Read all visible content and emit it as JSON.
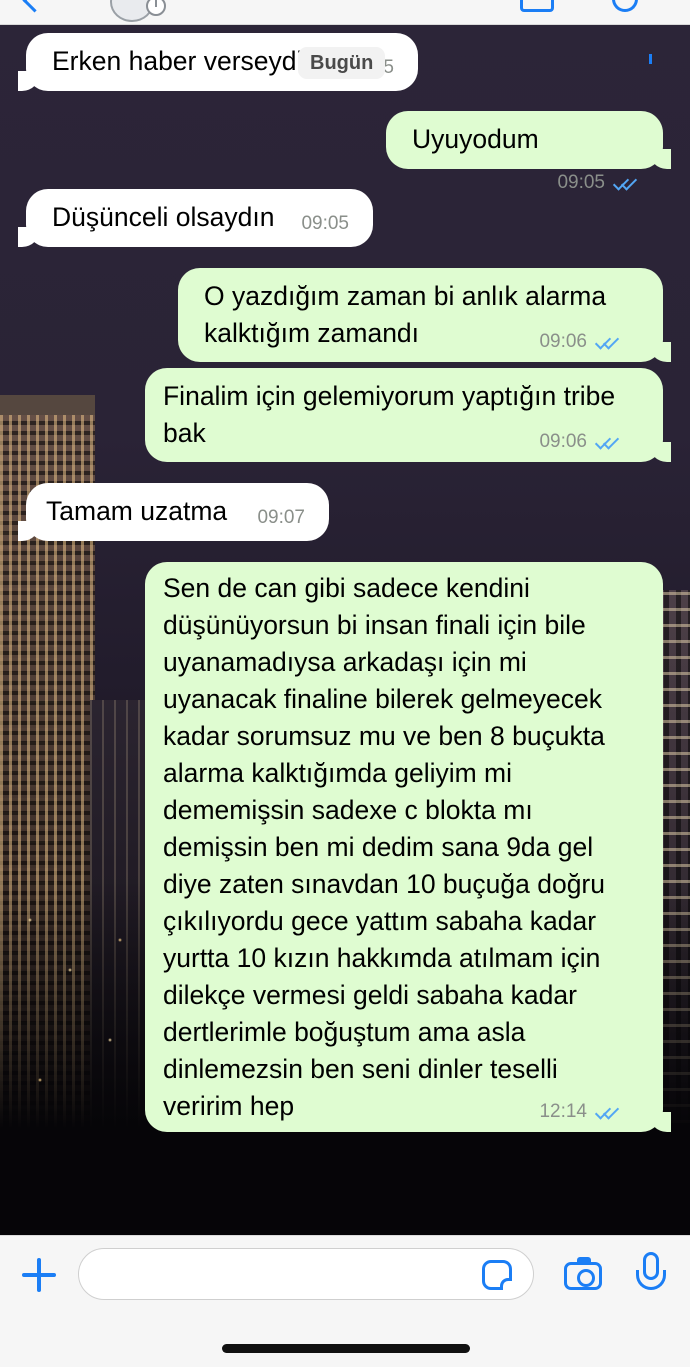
{
  "chat": {
    "date_label": "Bugün",
    "messages": [
      {
        "dir": "in",
        "text": "Erken haber verseydin",
        "time": "09:05"
      },
      {
        "dir": "out",
        "text": "Uyuyodum",
        "time": "09:05",
        "read": true
      },
      {
        "dir": "in",
        "text": "Düşünceli olsaydın",
        "time": "09:05"
      },
      {
        "dir": "out",
        "text": "O yazdığım zaman bi anlık alarma kalktığım zamandı",
        "time": "09:06",
        "read": true
      },
      {
        "dir": "out",
        "text": "Finalim için gelemiyorum yaptığın tribe bak",
        "time": "09:06",
        "read": true
      },
      {
        "dir": "in",
        "text": "Tamam uzatma",
        "time": "09:07"
      },
      {
        "dir": "out",
        "text": "Sen de can gibi sadece kendini düşünüyorsun bi insan finali için bile uyanamadıysa arkadaşı için mi uyanacak finaline bilerek gelmeyecek kadar sorumsuz mu ve ben 8 buçukta alarma kalktığımda geliyim mi dememişsin sadexe c blokta mı demişsin ben mi dedim sana 9da gel diye zaten sınavdan 10 buçuğa doğru çıkılıyordu gece yattım sabaha kadar yurtta 10 kızın hakkımda atılmam için dilekçe vermesi geldi sabaha kadar dertlerimle boğuştum ama asla dinlemezsin ben seni dinler teselli veririm hep",
        "time": "12:14",
        "read": true
      }
    ]
  },
  "composer": {
    "input_value": "",
    "input_placeholder": "",
    "icons": [
      "plus-icon",
      "sticker-icon",
      "camera-icon",
      "microphone-icon"
    ]
  },
  "colors": {
    "accent": "#1b7ef5",
    "outgoing_bubble": "#dffcd1",
    "incoming_bubble": "#ffffff",
    "read_ticks": "#53a6f4"
  }
}
